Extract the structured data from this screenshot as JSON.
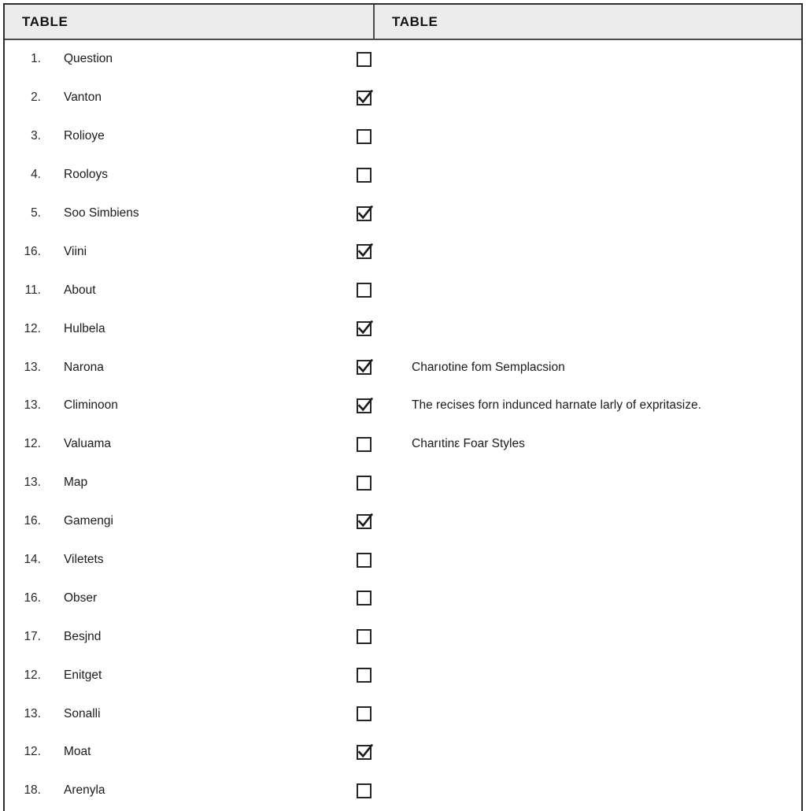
{
  "header": {
    "left_title": "TABLE",
    "right_title": "TABLE"
  },
  "rows": [
    {
      "index": "1.",
      "label": "Question",
      "checked": false,
      "note": ""
    },
    {
      "index": "2.",
      "label": "Vanton",
      "checked": true,
      "note": ""
    },
    {
      "index": "3.",
      "label": "Rolioye",
      "checked": false,
      "note": ""
    },
    {
      "index": "4.",
      "label": "Rooloys",
      "checked": false,
      "note": ""
    },
    {
      "index": "5.",
      "label": "Soo Simbiens",
      "checked": true,
      "note": ""
    },
    {
      "index": "16.",
      "label": "Viini",
      "checked": true,
      "note": ""
    },
    {
      "index": "11.",
      "label": "About",
      "checked": false,
      "note": ""
    },
    {
      "index": "12.",
      "label": "Hulbela",
      "checked": true,
      "note": ""
    },
    {
      "index": "13.",
      "label": "Narona",
      "checked": true,
      "note": "Charıotine fom Semplacsion"
    },
    {
      "index": "13.",
      "label": "Climinoon",
      "checked": true,
      "note": "The recises forn indunced harnate larly of expritasize."
    },
    {
      "index": "12.",
      "label": "Valuama",
      "checked": false,
      "note": "Charıtinε Foar Styles"
    },
    {
      "index": "13.",
      "label": "Map",
      "checked": false,
      "note": ""
    },
    {
      "index": "16.",
      "label": "Gamengi",
      "checked": true,
      "note": ""
    },
    {
      "index": "14.",
      "label": "Viletets",
      "checked": false,
      "note": ""
    },
    {
      "index": "16.",
      "label": "Obser",
      "checked": false,
      "note": ""
    },
    {
      "index": "17.",
      "label": "Besjnd",
      "checked": false,
      "note": ""
    },
    {
      "index": "12.",
      "label": "Enitget",
      "checked": false,
      "note": ""
    },
    {
      "index": "13.",
      "label": "Sonalli",
      "checked": false,
      "note": ""
    },
    {
      "index": "12.",
      "label": "Moat",
      "checked": true,
      "note": ""
    },
    {
      "index": "18.",
      "label": "Arenyla",
      "checked": false,
      "note": ""
    }
  ],
  "colors": {
    "header_background": "#ececec",
    "border": "#2e2e2e",
    "text": "#1b1b1b"
  }
}
